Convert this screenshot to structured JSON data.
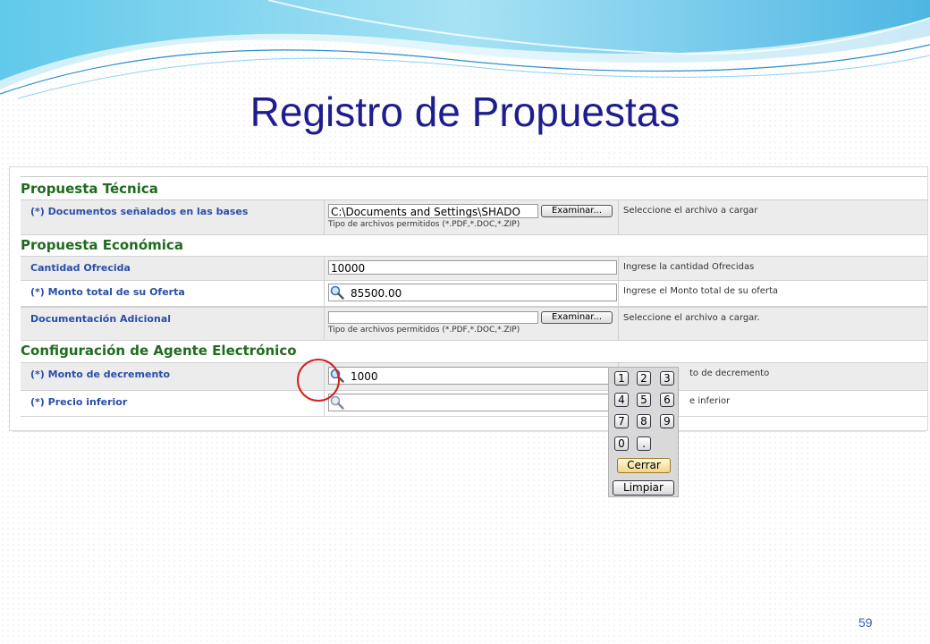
{
  "slide": {
    "title": "Registro de Propuestas",
    "page_number": "59"
  },
  "sections": {
    "tecnica": "Propuesta Técnica",
    "economica": "Propuesta Económica",
    "agente": "Configuración de Agente Electrónico"
  },
  "rows": {
    "documentos": {
      "label": "(*) Documentos señalados en las bases",
      "value": "C:\\Documents and Settings\\SHADO",
      "button": "Examinar...",
      "hint": "Seleccione el archivo a cargar",
      "subhint": "Tipo de archivos permitidos (*.PDF,*.DOC,*.ZIP)"
    },
    "cantidad": {
      "label": "Cantidad Ofrecida",
      "value": "10000",
      "hint": "Ingrese la cantidad Ofrecidas"
    },
    "monto_total": {
      "label": "(*) Monto total de su Oferta",
      "value": "85500.00",
      "hint": "Ingrese el Monto total de su oferta"
    },
    "documentacion": {
      "label": "Documentación Adicional",
      "value": "",
      "button": "Examinar...",
      "hint": "Seleccione el archivo a cargar.",
      "subhint": "Tipo de archivos permitidos (*.PDF,*.DOC,*.ZIP)"
    },
    "decremento": {
      "label": "(*) Monto de decremento",
      "value": "1000",
      "hint": "to de decremento"
    },
    "precio": {
      "label": "(*) Precio inferior",
      "value": "",
      "hint": "e inferior"
    }
  },
  "keypad": {
    "keys": [
      "1",
      "2",
      "3",
      "4",
      "5",
      "6",
      "7",
      "8",
      "9",
      "0",
      "."
    ],
    "close": "Cerrar",
    "clear": "Limpiar"
  },
  "colors": {
    "title": "#1d1d8c",
    "section": "#1f6b1f",
    "label": "#2a4fa8",
    "highlight_circle": "#d22020"
  },
  "icons": {
    "magnifier": "magnifier-icon"
  }
}
